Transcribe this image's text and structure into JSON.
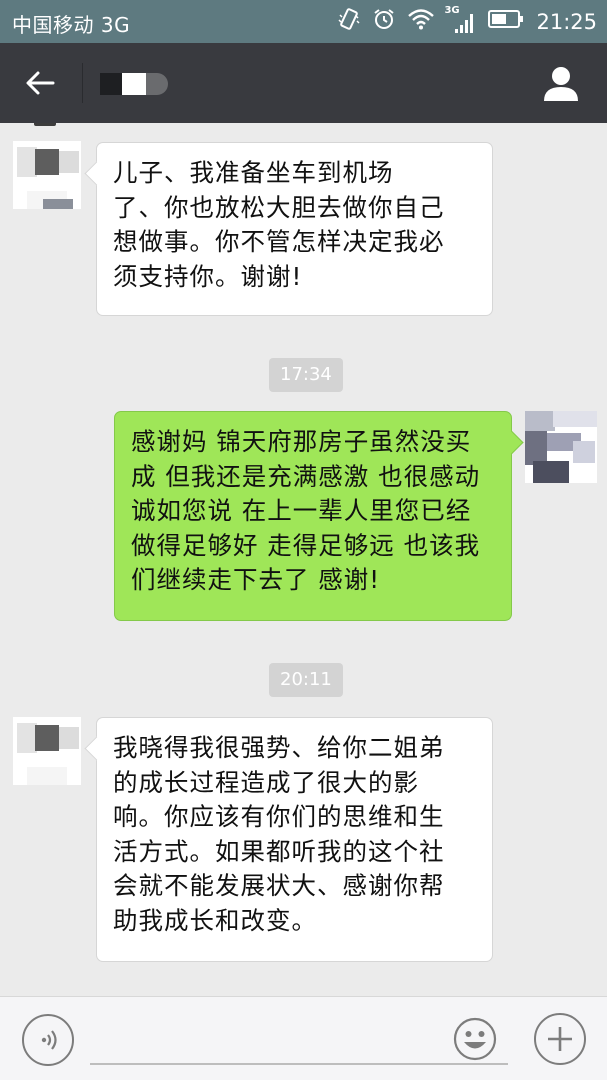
{
  "status_bar": {
    "carrier": "中国移动 3G",
    "network_label": "3G",
    "time": "21:25",
    "icons": [
      "vibrate-icon",
      "alarm-icon",
      "wifi-icon",
      "signal-icon",
      "battery-icon"
    ]
  },
  "title_bar": {
    "back_icon": "arrow-left-icon",
    "profile_icon": "person-icon"
  },
  "messages": [
    {
      "direction": "incoming",
      "text": "儿子、我准备坐车到机场\n了、你也放松大胆去做你自己\n想做事。你不管怎样决定我必\n须支持你。谢谢!"
    },
    {
      "timestamp": "17:34"
    },
    {
      "direction": "outgoing",
      "text": "感谢妈 锦天府那房子虽然没买\n成 但我还是充满感激 也很感动\n诚如您说 在上一辈人里您已经\n做得足够好 走得足够远 也该我\n们继续走下去了 感谢!"
    },
    {
      "timestamp": "20:11"
    },
    {
      "direction": "incoming",
      "text": "我晓得我很强势、给你二姐弟\n的成长过程造成了很大的影\n响。你应该有你们的思维和生\n活方式。如果都听我的这个社\n会就不能发展状大、感谢你帮\n助我成长和改变。"
    }
  ],
  "input_bar": {
    "voice_icon": "voice-icon",
    "emoji_icon": "smiley-icon",
    "plus_icon": "plus-icon",
    "placeholder": ""
  },
  "colors": {
    "status_bar": "#5e7a80",
    "title_bar": "#393a3f",
    "chat_background": "#ebebeb",
    "outgoing_bubble": "#9fe658",
    "incoming_bubble": "#ffffff",
    "timestamp_badge": "#d3d3d3"
  }
}
